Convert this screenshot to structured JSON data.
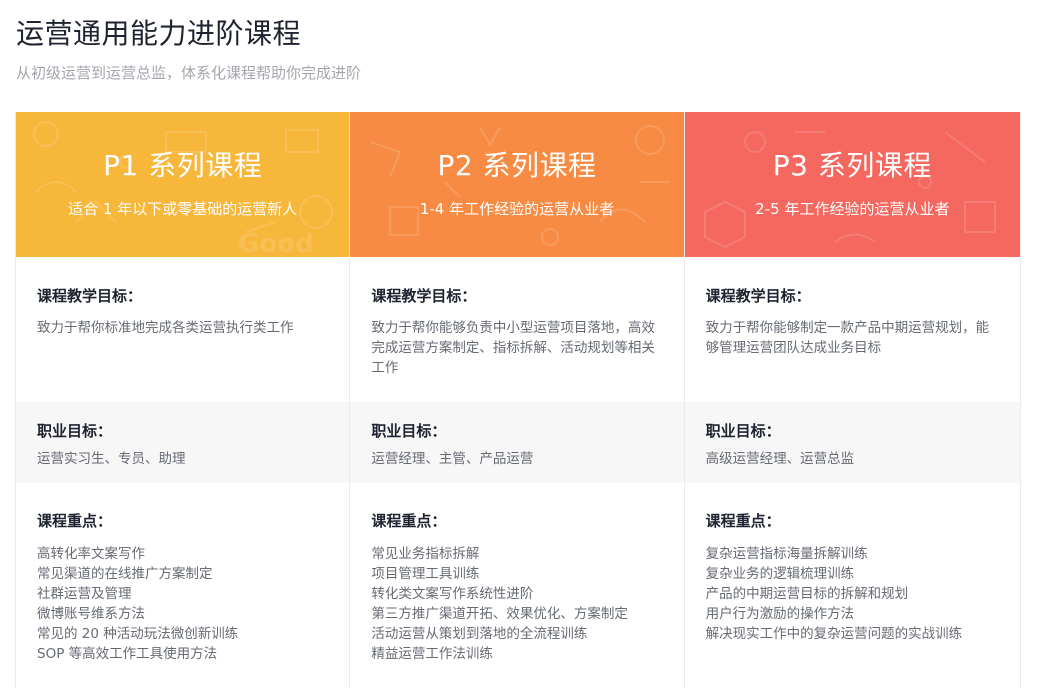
{
  "page": {
    "title": "运营通用能力进阶课程",
    "subtitle": "从初级运营到运营总监，体系化课程帮助你完成进阶"
  },
  "colors": {
    "p1": "#f7b73a",
    "p2": "#f78b43",
    "p3": "#f46860"
  },
  "section_labels": {
    "goal": "课程教学目标：",
    "career": "职业目标：",
    "focus": "课程重点："
  },
  "cards": [
    {
      "title": "P1 系列课程",
      "desc": "适合 1 年以下或零基础的运营新人",
      "goal": "致力于帮你标准地完成各类运营执行类工作",
      "career": "运营实习生、专员、助理",
      "focus": [
        "高转化率文案写作",
        "常见渠道的在线推广方案制定",
        "社群运营及管理",
        "微博账号维系方法",
        "常见的 20 种活动玩法微创新训练",
        "SOP 等高效工作工具使用方法"
      ]
    },
    {
      "title": "P2 系列课程",
      "desc": "1-4 年工作经验的运营从业者",
      "goal": "致力于帮你能够负责中小型运营项目落地，高效完成运营方案制定、指标拆解、活动规划等相关工作",
      "career": "运营经理、主管、产品运营",
      "focus": [
        "常见业务指标拆解",
        "项目管理工具训练",
        "转化类文案写作系统性进阶",
        "第三方推广渠道开拓、效果优化、方案制定",
        "活动运营从策划到落地的全流程训练",
        "精益运营工作法训练"
      ]
    },
    {
      "title": "P3 系列课程",
      "desc": "2-5 年工作经验的运营从业者",
      "goal": "致力于帮你能够制定一款产品中期运营规划，能够管理运营团队达成业务目标",
      "career": "高级运营经理、运营总监",
      "focus": [
        "复杂运营指标海量拆解训练",
        "复杂业务的逻辑梳理训练",
        "产品的中期运营目标的拆解和规划",
        "用户行为激励的操作方法",
        "解决现实工作中的复杂运营问题的实战训练"
      ]
    }
  ]
}
